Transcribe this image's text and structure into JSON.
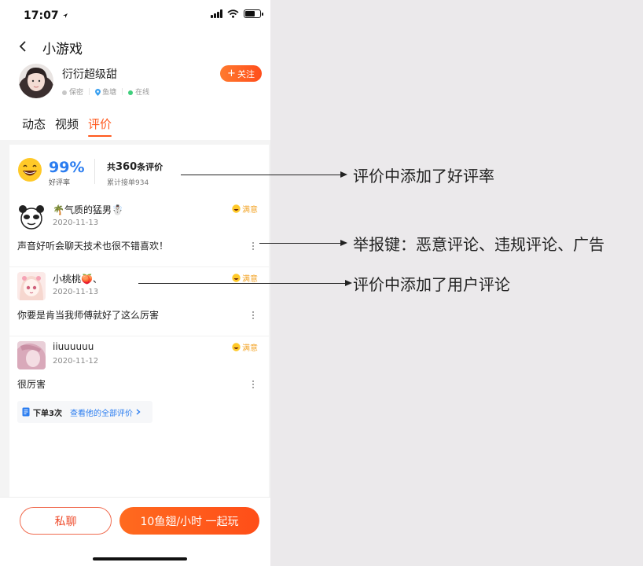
{
  "status_bar": {
    "time": "17:07",
    "location_icon": "location-arrow-icon"
  },
  "header": {
    "title": "小游戏",
    "user": {
      "name": "衍衍超级甜",
      "tags": [
        "保密",
        "鱼塘",
        "在线"
      ]
    },
    "follow_label": "关注",
    "tabs": [
      {
        "label": "动态"
      },
      {
        "label": "视频"
      },
      {
        "label": "评价",
        "active": true
      }
    ]
  },
  "rating": {
    "rate": "99%",
    "rate_label": "好评率",
    "count_prefix": "共",
    "count": "360",
    "count_suffix": "条评价",
    "total_orders": "累计接单934"
  },
  "reviews": [
    {
      "name": "🌴气质的猛男☃️",
      "date": "2020-11-13",
      "badge": "满意",
      "text": "声音好听会聊天技术也很不错喜欢！"
    },
    {
      "name": "小桃桃🍑、",
      "date": "2020-11-13",
      "badge": "满意",
      "text": "你要是肯当我师傅就好了这么厉害"
    },
    {
      "name": "iiuuuuuu",
      "date": "2020-11-12",
      "badge": "满意",
      "text": "很厉害"
    }
  ],
  "order_box": {
    "count_text": "下单3次",
    "link_text": "查看他的全部评价"
  },
  "bottom": {
    "chat_label": "私聊",
    "play_label": "10鱼翅/小时 一起玩"
  },
  "annotations": [
    {
      "text": "评价中添加了好评率"
    },
    {
      "text": "举报键：恶意评论、违规评论、广告"
    },
    {
      "text": "评价中添加了用户评论"
    }
  ],
  "colors": {
    "accent": "#ff5a1f",
    "blue": "#2b7df0",
    "badge": "#f3a62b"
  }
}
